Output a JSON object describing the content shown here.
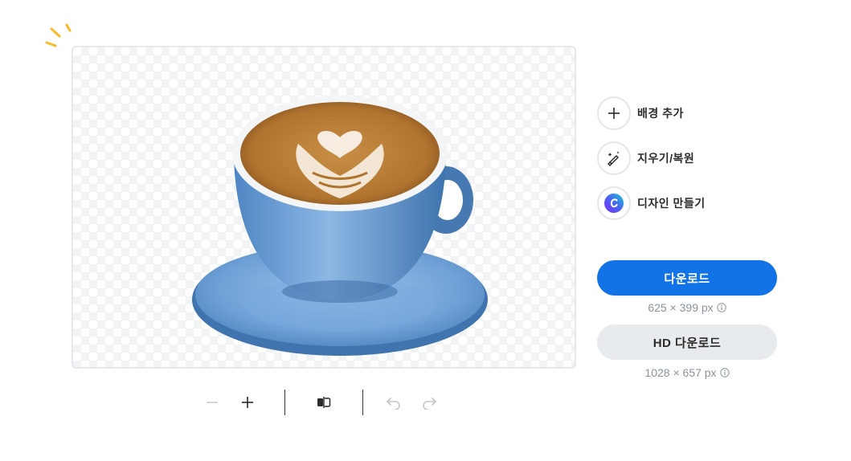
{
  "editor": {
    "zoom_out_icon": "minus-icon",
    "zoom_in_icon": "plus-icon",
    "compare_icon": "split-compare-icon",
    "undo_icon": "undo-icon",
    "redo_icon": "redo-icon"
  },
  "sidebar": {
    "items": [
      {
        "label": "배경 추가",
        "icon": "plus-icon"
      },
      {
        "label": "지우기/복원",
        "icon": "magic-brush-icon"
      },
      {
        "label": "디자인 만들기",
        "icon": "canva-logo-icon"
      }
    ]
  },
  "download": {
    "label": "다운로드",
    "size": "625 × 399 px",
    "hd_label": "HD 다운로드",
    "hd_size": "1028 × 657 px"
  },
  "colors": {
    "primary": "#1273e6",
    "secondary_bg": "#e8ebee",
    "sparkle": "#f7b928"
  }
}
